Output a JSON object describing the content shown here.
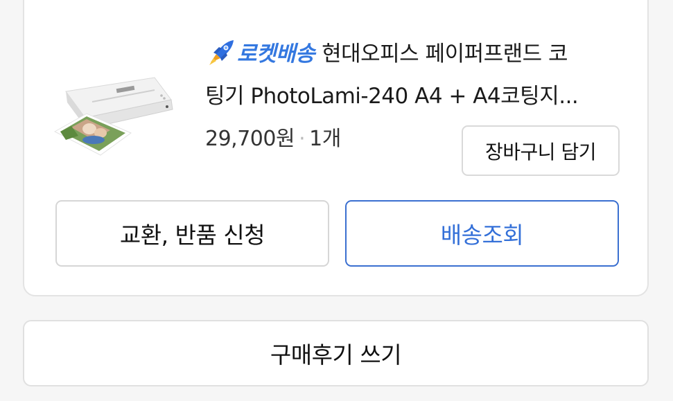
{
  "order": {
    "badge": {
      "icon": "rocket-icon",
      "label": "로켓배송",
      "color": "#3478e0"
    },
    "product": {
      "title_line1": "현대오피스 페이퍼프랜드 코",
      "title_line2": "팅기 PhotoLami-240 A4 + A4코팅지...",
      "thumbnail": "laminator-product-image"
    },
    "price": "29,700원",
    "separator": "·",
    "quantity": "1개",
    "cart_button_label": "장바구니 담기",
    "return_button_label": "교환, 반품 신청",
    "track_button_label": "배송조회",
    "accent_color": "#3470d8"
  },
  "review_button_label": "구매후기 쓰기"
}
